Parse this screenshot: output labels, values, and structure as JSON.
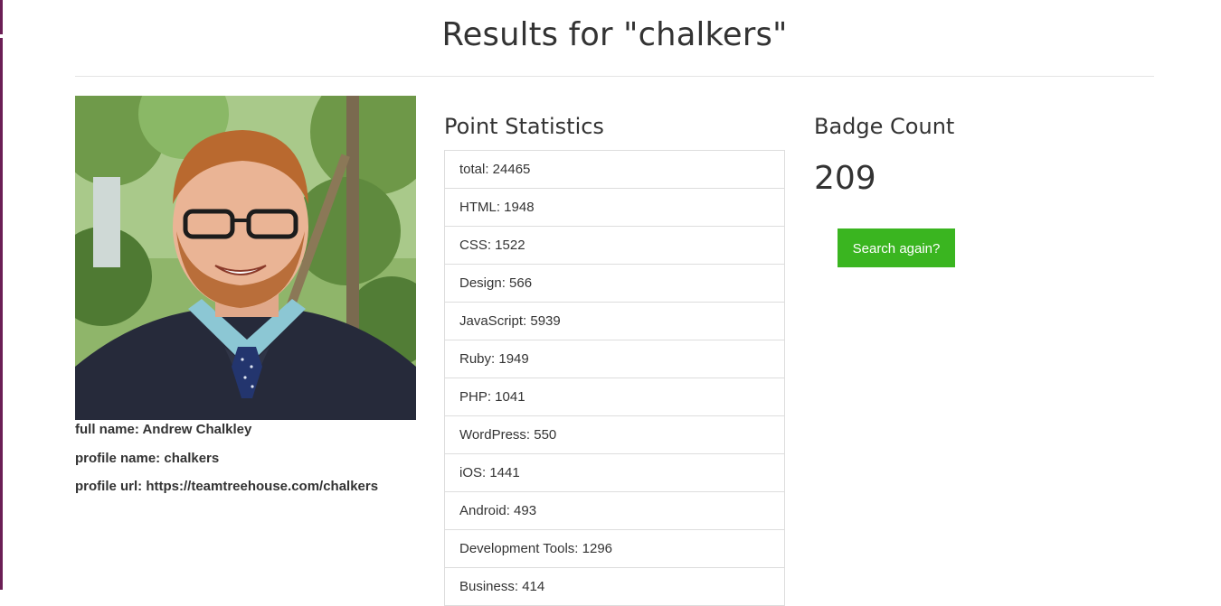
{
  "page": {
    "title": "Results for \"chalkers\""
  },
  "profile": {
    "full_name": "full name: Andrew Chalkley",
    "profile_name": "profile name: chalkers",
    "profile_url": "profile url: https://teamtreehouse.com/chalkers",
    "avatar_icon": "profile-photo"
  },
  "points": {
    "heading": "Point Statistics",
    "items": [
      "total: 24465",
      "HTML: 1948",
      "CSS: 1522",
      "Design: 566",
      "JavaScript: 5939",
      "Ruby: 1949",
      "PHP: 1041",
      "WordPress: 550",
      "iOS: 1441",
      "Android: 493",
      "Development Tools: 1296",
      "Business: 414"
    ]
  },
  "badges": {
    "heading": "Badge Count",
    "count": "209",
    "search_again_label": "Search again?"
  },
  "colors": {
    "accent_green": "#3ab520",
    "edge_purple": "#6b1f55"
  }
}
